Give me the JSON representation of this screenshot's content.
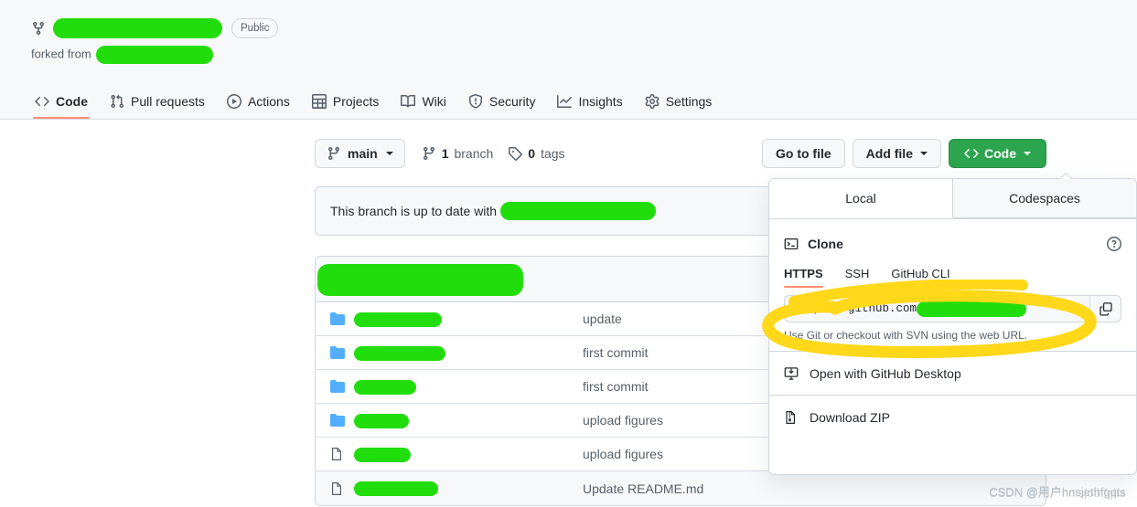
{
  "repo": {
    "name_redacted": true,
    "visibility_badge": "Public",
    "forked_from_label": "forked from",
    "fork_icon": "repo-forked-icon"
  },
  "nav": {
    "items": [
      {
        "label": "Code",
        "icon": "code-icon",
        "active": true
      },
      {
        "label": "Pull requests",
        "icon": "git-pull-request-icon",
        "active": false
      },
      {
        "label": "Actions",
        "icon": "play-icon",
        "active": false
      },
      {
        "label": "Projects",
        "icon": "table-icon",
        "active": false
      },
      {
        "label": "Wiki",
        "icon": "book-icon",
        "active": false
      },
      {
        "label": "Security",
        "icon": "shield-icon",
        "active": false
      },
      {
        "label": "Insights",
        "icon": "graph-icon",
        "active": false
      },
      {
        "label": "Settings",
        "icon": "gear-icon",
        "active": false
      }
    ]
  },
  "toolbar": {
    "branch_name": "main",
    "branch_icon": "git-branch-icon",
    "branch_count": "1",
    "branch_count_label": "branch",
    "tag_count": "0",
    "tag_count_label": "tags",
    "tag_icon": "tag-icon",
    "go_to_file": "Go to file",
    "add_file": "Add file",
    "code_button": "Code"
  },
  "branch_status": {
    "text": "This branch is up to date with"
  },
  "files": {
    "rows": [
      {
        "type": "folder",
        "icon": "folder-icon",
        "name_redacted": true,
        "redact_width": 96,
        "commit": "update"
      },
      {
        "type": "folder",
        "icon": "folder-icon",
        "name_redacted": true,
        "redact_width": 100,
        "commit": "first commit"
      },
      {
        "type": "folder",
        "icon": "folder-icon",
        "name_redacted": true,
        "redact_width": 68,
        "commit": "first commit"
      },
      {
        "type": "folder",
        "icon": "folder-icon",
        "name_redacted": true,
        "redact_width": 60,
        "commit": "upload figures"
      },
      {
        "type": "file",
        "icon": "file-icon",
        "name_redacted": true,
        "redact_width": 62,
        "commit": "upload figures"
      },
      {
        "type": "file",
        "icon": "file-icon",
        "name_redacted": true,
        "redact_width": 92,
        "commit": "Update README.md"
      }
    ]
  },
  "code_panel": {
    "tabs": [
      {
        "label": "Local",
        "active": true
      },
      {
        "label": "Codespaces",
        "active": false
      }
    ],
    "clone_title": "Clone",
    "clone_icon": "terminal-icon",
    "help_icon": "question-icon",
    "protocols": [
      {
        "label": "HTTPS",
        "active": true
      },
      {
        "label": "SSH",
        "active": false
      },
      {
        "label": "GitHub CLI",
        "active": false
      }
    ],
    "url_value": "https://github.com",
    "url_redacted": true,
    "copy_icon": "copy-icon",
    "url_help": "Use Git or checkout with SVN using the web URL.",
    "items": [
      {
        "label": "Open with GitHub Desktop",
        "icon": "desktop-download-icon"
      },
      {
        "label": "Download ZIP",
        "icon": "file-zip-icon"
      }
    ]
  },
  "annotations": {
    "highlighter_color": "#FFD819",
    "redaction_color": "#22DD0C",
    "accent_green": "#2DA44E",
    "accent_orange": "#FD8C73",
    "link_blue": "#0969DA"
  },
  "watermark": {
    "text": "CSDN @用户hnsjethfgqts",
    "ghost": "CSDN @用户hmsjothfglts"
  }
}
